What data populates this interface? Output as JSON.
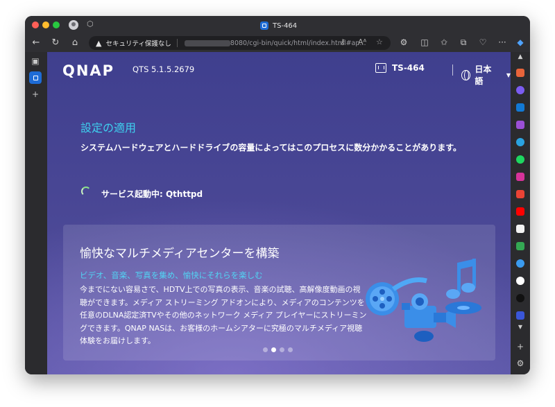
{
  "browser": {
    "tab_title": "TS-464",
    "security_label": "セキュリティ保護なし",
    "url": "8080/cgi-bin/quick/html/index.html#ap...",
    "toolbar_icons": [
      "back-icon",
      "refresh-icon",
      "home-icon"
    ],
    "right_toolbar_icons": [
      "extensions-icon",
      "split-screen-icon",
      "favorites-icon",
      "collections-icon",
      "performance-icon",
      "more-icon",
      "copilot-icon"
    ]
  },
  "header": {
    "logo": "QNAP",
    "version": "QTS 5.1.5.2679",
    "device_name": "TS-464",
    "language": "日本語"
  },
  "setup": {
    "title": "設定の適用",
    "description": "システムハードウェアとハードドライブの容量によってはこのプロセスに数分かかることがあります。",
    "service_status": "サービス起動中: Qthttpd"
  },
  "promo": {
    "title": "愉快なマルチメディアセンターを構築",
    "subtitle": "ビデオ、音楽、写真を集め、愉快にそれらを楽しむ",
    "body": "今までにない容易さで、HDTV上での写真の表示、音楽の試聴、高解像度動画の視聴ができます。メディア ストリーミング アドオンにより、メディアのコンテンツを任意のDLNA認定済TVやその他のネットワーク メディア プレイヤーにストリーミングできます。QNAP NASは、お客様のホームシアターに究極のマルチメディア視聴体験をお届けします。",
    "slides_total": 4,
    "active_slide": 2
  },
  "sidebar_icons": [
    "shopping-icon",
    "copilot-app-icon",
    "outlook-icon",
    "games-icon",
    "telegram-icon",
    "spotify-icon",
    "instagram-icon",
    "gmail-icon",
    "youtube-icon",
    "amazon-icon",
    "drive-icon",
    "onedrive-icon",
    "google-icon",
    "threads-icon",
    "other-app-icon"
  ],
  "colors": {
    "accent": "#3ed1f0",
    "brand": "#1e6cd6"
  }
}
